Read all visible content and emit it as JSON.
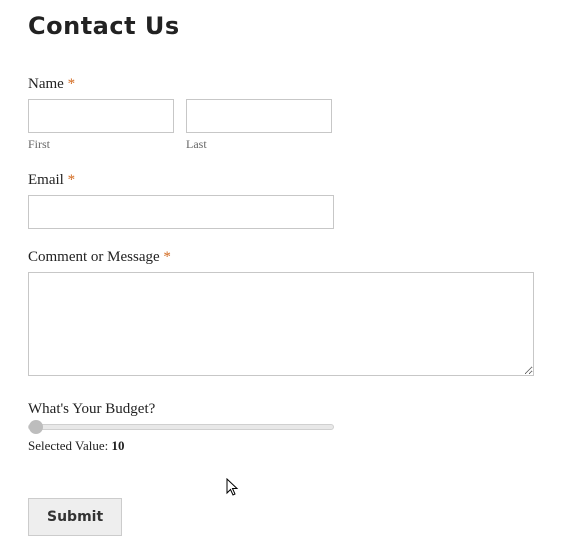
{
  "page": {
    "title": "Contact Us"
  },
  "form": {
    "name": {
      "label": "Name",
      "required_mark": "*",
      "first": {
        "sublabel": "First",
        "value": ""
      },
      "last": {
        "sublabel": "Last",
        "value": ""
      }
    },
    "email": {
      "label": "Email",
      "required_mark": "*",
      "value": ""
    },
    "message": {
      "label": "Comment or Message",
      "required_mark": "*",
      "value": ""
    },
    "budget": {
      "label": "What's Your Budget?",
      "selected_label": "Selected Value: ",
      "selected_value": "10"
    },
    "submit": {
      "label": "Submit"
    }
  }
}
